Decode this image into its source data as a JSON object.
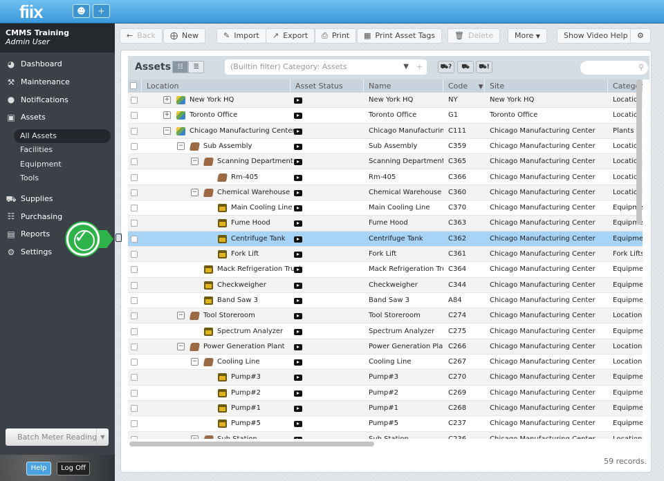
{
  "app": {
    "logo": "fiix",
    "user_icon": "user-icon",
    "add_icon": "plus-icon"
  },
  "sidebar": {
    "org": "CMMS Training",
    "user": "Admin User",
    "items": [
      {
        "label": "Dashboard",
        "icon": "dashboard-icon"
      },
      {
        "label": "Maintenance",
        "icon": "tools-icon"
      },
      {
        "label": "Notifications",
        "icon": "speech-bubble-icon"
      },
      {
        "label": "Assets",
        "icon": "box-icon"
      }
    ],
    "asset_sub": [
      "All Assets",
      "Facilities",
      "Equipment",
      "Tools"
    ],
    "items2": [
      {
        "label": "Supplies",
        "icon": "truck-icon"
      },
      {
        "label": "Purchasing",
        "icon": "cart-icon"
      },
      {
        "label": "Reports",
        "icon": "chart-icon"
      },
      {
        "label": "Settings",
        "icon": "gear-icon"
      }
    ],
    "batch": "Batch Meter Reading",
    "help": "Help",
    "logoff": "Log Off"
  },
  "toolbar": {
    "back": "Back",
    "new": "New",
    "import": "Import",
    "export": "Export",
    "print": "Print",
    "print_tags": "Print Asset Tags",
    "delete": "Delete",
    "more": "More",
    "video_help": "Show Video Help"
  },
  "panel": {
    "title": "Assets",
    "filter": "(Builtin filter) Category: Assets",
    "tk1": "?",
    "tk3": "!",
    "records": "59 records."
  },
  "columns": [
    "Location",
    "Asset Status",
    "Name",
    "Code",
    "Site",
    "Category"
  ],
  "rows": [
    {
      "loc": "New York HQ",
      "lvl": 0,
      "tg": "+",
      "icon": "loc",
      "name": "New York HQ",
      "code": "NY",
      "site": "New York HQ",
      "cat": "Locations And Facilities"
    },
    {
      "loc": "Toronto Office",
      "lvl": 0,
      "tg": "+",
      "icon": "loc",
      "name": "Toronto Office",
      "code": "G1",
      "site": "Toronto Office",
      "cat": "Locations And Facilities"
    },
    {
      "loc": "Chicago Manufacturing Center",
      "lvl": 0,
      "tg": "−",
      "icon": "loc",
      "name": "Chicago Manufacturing...",
      "code": "C111",
      "site": "Chicago Manufacturing Center",
      "cat": "Plants"
    },
    {
      "loc": "Sub Assembly",
      "lvl": 1,
      "tg": "−",
      "icon": "bld",
      "name": "Sub Assembly",
      "code": "C359",
      "site": "Chicago Manufacturing Center",
      "cat": "Locations And Facilities"
    },
    {
      "loc": "Scanning Department",
      "lvl": 2,
      "tg": "−",
      "icon": "bld",
      "name": "Scanning Department",
      "code": "C365",
      "site": "Chicago Manufacturing Center",
      "cat": "Locations And Facilities"
    },
    {
      "loc": "Rm-405",
      "lvl": 3,
      "tg": "",
      "icon": "bld",
      "name": "Rm-405",
      "code": "C366",
      "site": "Chicago Manufacturing Center",
      "cat": "Locations And Facilities"
    },
    {
      "loc": "Chemical Warehouse",
      "lvl": 2,
      "tg": "−",
      "icon": "bld",
      "name": "Chemical Warehouse",
      "code": "C360",
      "site": "Chicago Manufacturing Center",
      "cat": "Locations And Facilities"
    },
    {
      "loc": "Main Cooling Line",
      "lvl": 3,
      "tg": "",
      "icon": "eq",
      "name": "Main Cooling Line",
      "code": "C370",
      "site": "Chicago Manufacturing Center",
      "cat": "Equipment"
    },
    {
      "loc": "Fume Hood",
      "lvl": 3,
      "tg": "",
      "icon": "eq",
      "name": "Fume Hood",
      "code": "C363",
      "site": "Chicago Manufacturing Center",
      "cat": "Equipment"
    },
    {
      "loc": "Centrifuge Tank",
      "lvl": 3,
      "tg": "",
      "icon": "eq",
      "name": "Centrifuge Tank",
      "code": "C362",
      "site": "Chicago Manufacturing Center",
      "cat": "Equipment",
      "selected": true
    },
    {
      "loc": "Fork Lift",
      "lvl": 3,
      "tg": "",
      "icon": "eq",
      "name": "Fork Lift",
      "code": "C361",
      "site": "Chicago Manufacturing Center",
      "cat": "Fork Lifts"
    },
    {
      "loc": "Mack Refrigeration Truck",
      "lvl": 2,
      "tg": "",
      "icon": "eq",
      "name": "Mack Refrigeration Truck",
      "code": "C364",
      "site": "Chicago Manufacturing Center",
      "cat": "Equipment"
    },
    {
      "loc": "Checkweigher",
      "lvl": 2,
      "tg": "",
      "icon": "eq",
      "name": "Checkweigher",
      "code": "C344",
      "site": "Chicago Manufacturing Center",
      "cat": "Equipment"
    },
    {
      "loc": "Band Saw 3",
      "lvl": 2,
      "tg": "",
      "icon": "eq",
      "name": "Band Saw 3",
      "code": "A84",
      "site": "Chicago Manufacturing Center",
      "cat": "Equipment"
    },
    {
      "loc": "Tool Storeroom",
      "lvl": 1,
      "tg": "−",
      "icon": "bld",
      "name": "Tool Storeroom",
      "code": "C274",
      "site": "Chicago Manufacturing Center",
      "cat": "Locations And Facilities"
    },
    {
      "loc": "Spectrum Analyzer",
      "lvl": 2,
      "tg": "",
      "icon": "eq",
      "name": "Spectrum Analyzer",
      "code": "C275",
      "site": "Chicago Manufacturing Center",
      "cat": "Equipment"
    },
    {
      "loc": "Power Generation Plant",
      "lvl": 1,
      "tg": "−",
      "icon": "bld",
      "name": "Power Generation Plant",
      "code": "C266",
      "site": "Chicago Manufacturing Center",
      "cat": "Locations And Facilities"
    },
    {
      "loc": "Cooling Line",
      "lvl": 2,
      "tg": "−",
      "icon": "bld",
      "name": "Cooling Line",
      "code": "C267",
      "site": "Chicago Manufacturing Center",
      "cat": "Locations And Facilities"
    },
    {
      "loc": "Pump#3",
      "lvl": 3,
      "tg": "",
      "icon": "eq",
      "name": "Pump#3",
      "code": "C270",
      "site": "Chicago Manufacturing Center",
      "cat": "Equipment"
    },
    {
      "loc": "Pump#2",
      "lvl": 3,
      "tg": "",
      "icon": "eq",
      "name": "Pump#2",
      "code": "C269",
      "site": "Chicago Manufacturing Center",
      "cat": "Equipment"
    },
    {
      "loc": "Pump#1",
      "lvl": 3,
      "tg": "",
      "icon": "eq",
      "name": "Pump#1",
      "code": "C268",
      "site": "Chicago Manufacturing Center",
      "cat": "Equipment"
    },
    {
      "loc": "Pump#5",
      "lvl": 3,
      "tg": "",
      "icon": "eq",
      "name": "Pump#5",
      "code": "C237",
      "site": "Chicago Manufacturing Center",
      "cat": "Equipment"
    },
    {
      "loc": "Sub Station",
      "lvl": 2,
      "tg": "−",
      "icon": "bld",
      "name": "Sub Station",
      "code": "C236",
      "site": "Chicago Manufacturing Center",
      "cat": "Locations And Facilities"
    }
  ],
  "colors": {
    "accent": "#3a98d9",
    "selected_row": "#a7d3f7",
    "pin": "#2db34a"
  }
}
